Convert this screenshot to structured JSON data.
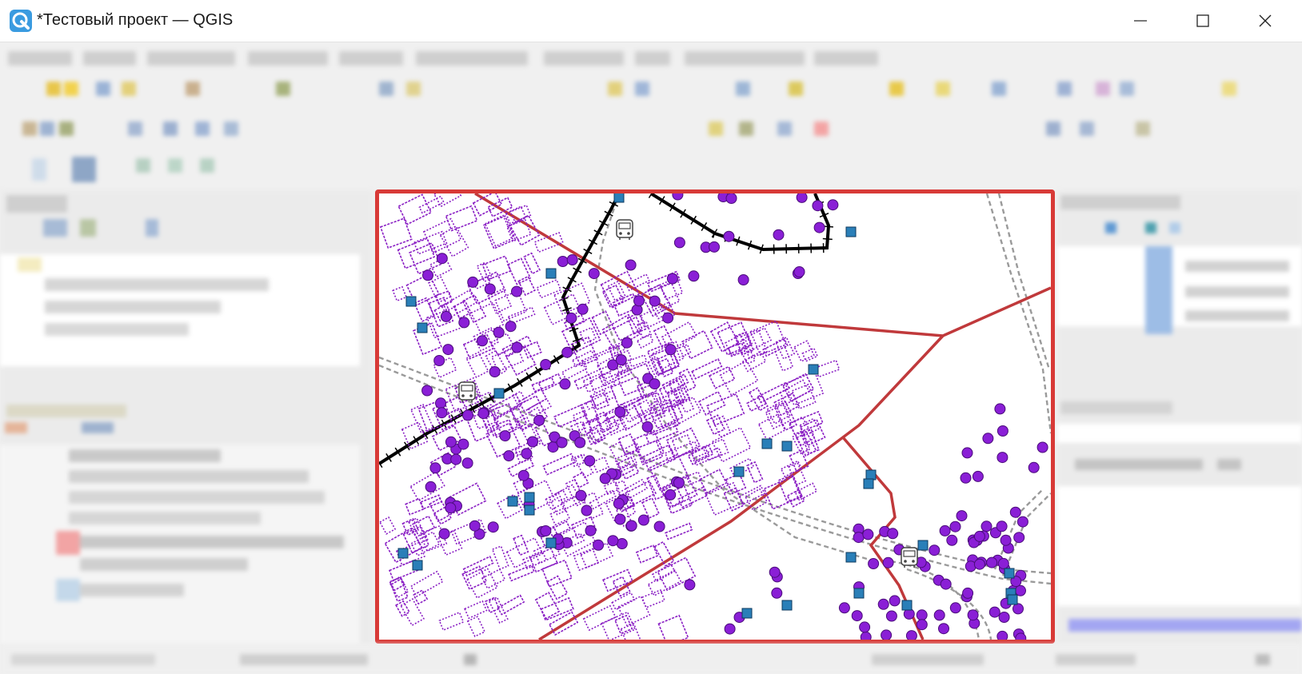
{
  "window": {
    "title": "*Тестовый проект — QGIS",
    "controls": [
      "minimize",
      "maximize",
      "close"
    ]
  },
  "map_canvas": {
    "highlight_color": "#d83a37",
    "layers": [
      {
        "name": "buildings",
        "color": "#8a1fc4"
      },
      {
        "name": "points",
        "color": "#8a1fd6"
      },
      {
        "name": "stops",
        "color": "#2a7fb8"
      },
      {
        "name": "rail",
        "color": "#000000"
      },
      {
        "name": "boundaries",
        "color": "#c0393b"
      },
      {
        "name": "paths",
        "color": "#9a9a9a"
      }
    ]
  },
  "icons": {
    "app": "qgis-logo-icon",
    "minimize": "minimize-icon",
    "maximize": "maximize-icon",
    "close": "close-icon",
    "bus": "bus-icon"
  }
}
